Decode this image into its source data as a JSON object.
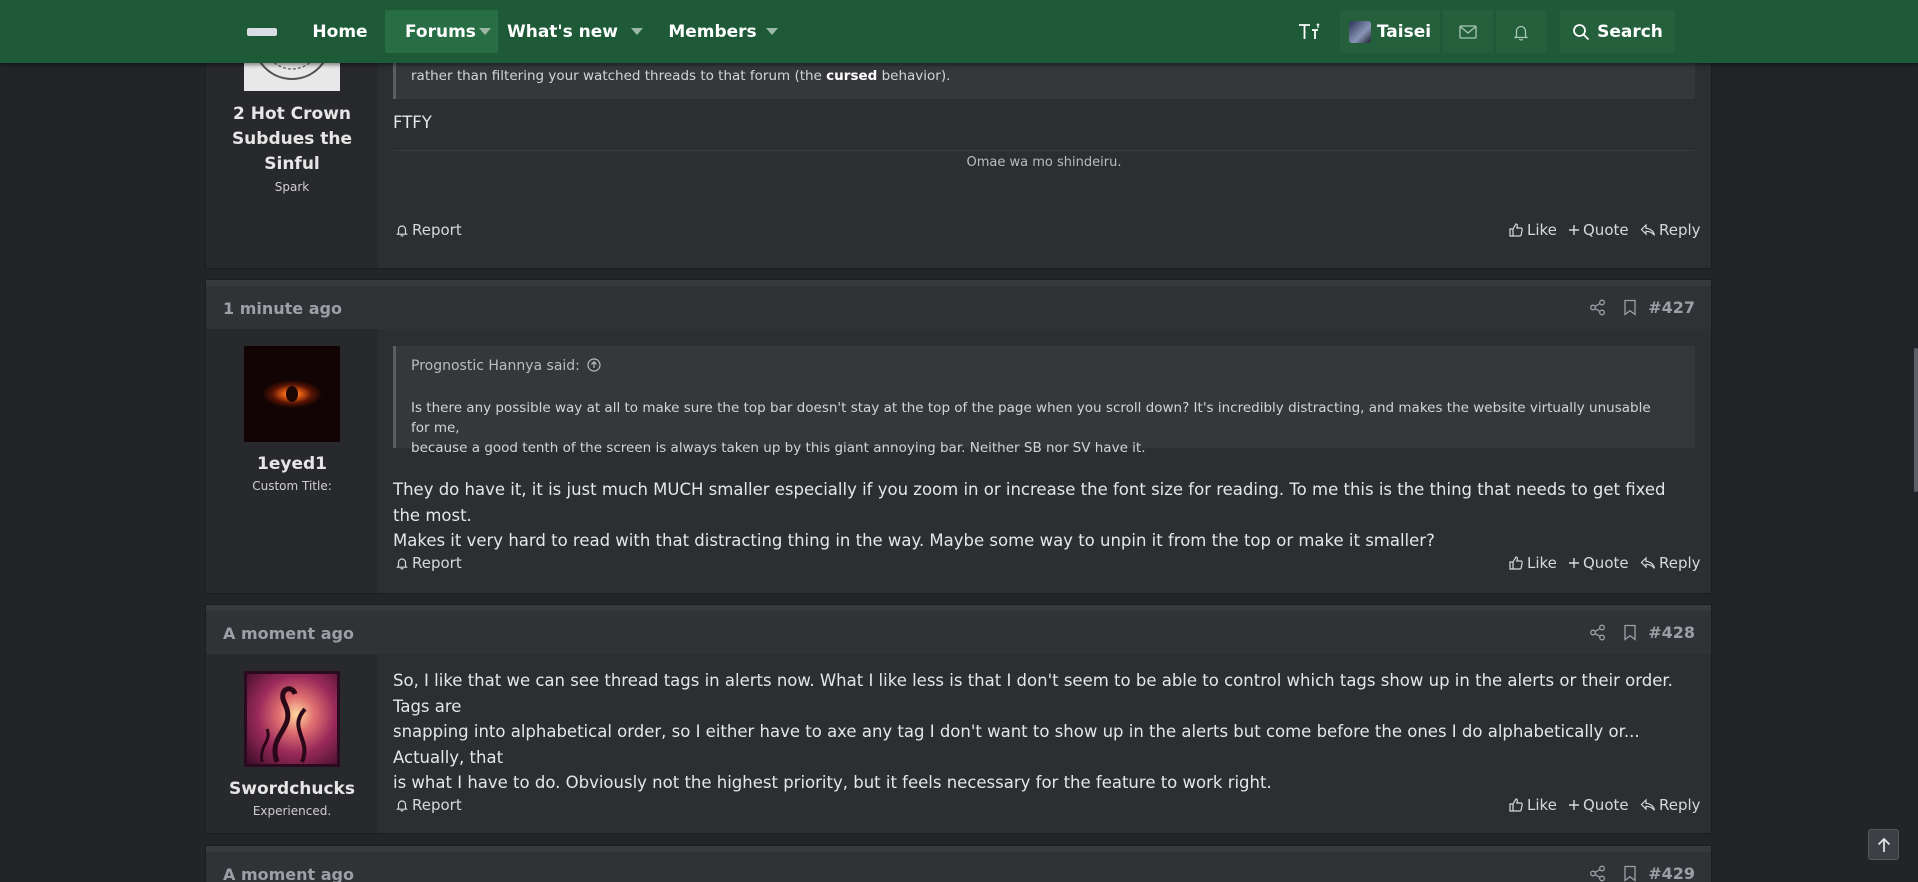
{
  "nav": {
    "items": [
      {
        "label": "Home"
      },
      {
        "label": "Forums"
      },
      {
        "label": "What's new"
      },
      {
        "label": "Members"
      }
    ],
    "user_name": "Taisei",
    "search_label": "Search"
  },
  "posts": [
    {
      "user": {
        "name_lines": [
          "2 Hot Crown",
          "Subdues the",
          "Sinful"
        ],
        "title": "Spark"
      },
      "quote_tail": {
        "before": "rather than filtering your watched threads to that forum (the ",
        "bold": "cursed",
        "after": " behavior)."
      },
      "message": "FTFY",
      "signature": "Omae wa mo shindeiru.",
      "actions": {
        "report": "Report",
        "like": "Like",
        "quote": "Quote",
        "reply": "Reply"
      }
    },
    {
      "time": "1 minute ago",
      "number": "#427",
      "user": {
        "name": "1eyed1",
        "title": "Custom Title:"
      },
      "quote": {
        "author": "Prognostic Hannya said:",
        "lines": [
          "Is there any possible way at all to make sure the top bar doesn't stay at the top of the page when you scroll down? It's incredibly distracting, and makes the website virtually unusable for me,",
          "because a good tenth of the screen is always taken up by this giant annoying bar. Neither SB nor SV have it."
        ]
      },
      "message_lines": [
        "They do have it, it is just much MUCH smaller especially if you zoom in or increase the font size for reading. To me this is the thing that needs to get fixed the most.",
        "Makes it very hard to read with that distracting thing in the way. Maybe some way to unpin it from the top or make it smaller?"
      ],
      "actions": {
        "report": "Report",
        "like": "Like",
        "quote": "Quote",
        "reply": "Reply"
      }
    },
    {
      "time": "A moment ago",
      "number": "#428",
      "user": {
        "name": "Swordchucks",
        "title": "Experienced."
      },
      "message_lines": [
        "So, I like that we can see thread tags in alerts now. What I like less is that I don't seem to be able to control which tags show up in the alerts or their order. Tags are",
        "snapping into alphabetical order, so I either have to axe any tag I don't want to show up in the alerts but come before the ones I do alphabetically or... Actually, that",
        "is what I have to do. Obviously not the highest priority, but it feels necessary for the feature to work right."
      ],
      "actions": {
        "report": "Report",
        "like": "Like",
        "quote": "Quote",
        "reply": "Reply"
      }
    },
    {
      "time": "A moment ago",
      "number": "#429"
    }
  ]
}
